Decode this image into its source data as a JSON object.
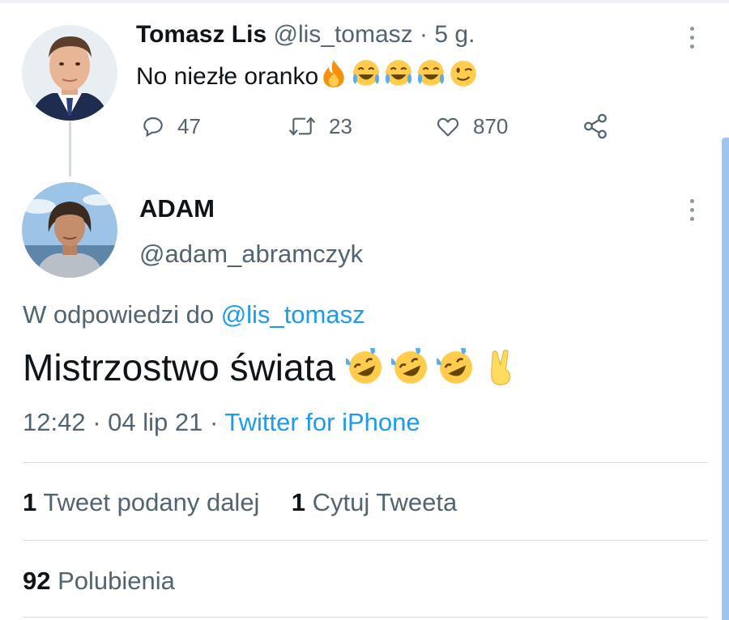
{
  "original_tweet": {
    "display_name": "Tomasz Lis",
    "handle": "@lis_tomasz",
    "separator": "·",
    "age": "5 g.",
    "text": "No niezłe oranko",
    "emojis": [
      "fire-emoji",
      "tears-of-joy-emoji",
      "tears-of-joy-emoji",
      "tears-of-joy-emoji",
      "winking-face-emoji"
    ],
    "reply_count": "47",
    "retweet_count": "23",
    "like_count": "870"
  },
  "reply_tweet": {
    "display_name": "ADAM",
    "handle": "@adam_abramczyk",
    "replying_to_label": "W odpowiedzi do",
    "replying_to_handle": "@lis_tomasz",
    "text": "Mistrzostwo świata",
    "emojis": [
      "rofl-emoji",
      "rofl-emoji",
      "rofl-emoji",
      "victory-hand-emoji"
    ],
    "time": "12:42",
    "date": "04 lip 21",
    "separator": "·",
    "source": "Twitter for iPhone",
    "retweet_count": "1",
    "retweet_label": "Tweet podany dalej",
    "quote_count": "1",
    "quote_label": "Cytuj Tweeta",
    "like_count": "92",
    "like_label": "Polubienia"
  },
  "colors": {
    "link": "#1d9bf0",
    "muted": "#536471",
    "divider": "#d5dbe0",
    "scrollbar": "#9ec5ea"
  }
}
